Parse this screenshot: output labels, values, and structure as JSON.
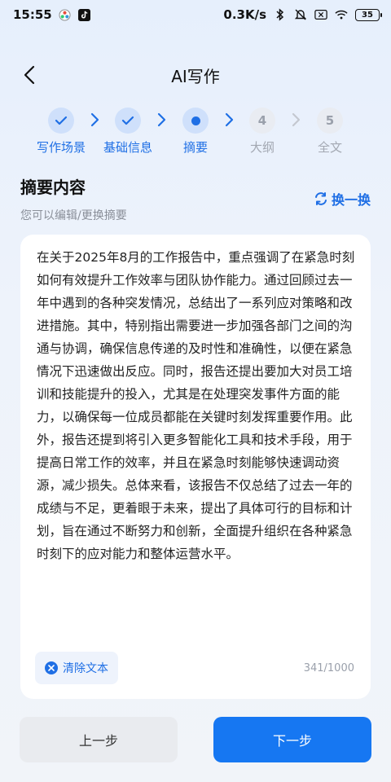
{
  "status_bar": {
    "time": "15:55",
    "network_speed": "0.3K/s",
    "battery": "35"
  },
  "nav": {
    "title": "AI写作"
  },
  "steps": [
    {
      "label": "写作场景",
      "state": "done"
    },
    {
      "label": "基础信息",
      "state": "done"
    },
    {
      "label": "摘要",
      "state": "active"
    },
    {
      "label": "大纲",
      "state": "pending",
      "number": "4"
    },
    {
      "label": "全文",
      "state": "pending",
      "number": "5"
    }
  ],
  "section": {
    "title": "摘要内容",
    "subtitle": "您可以编辑/更换摘要",
    "swap_label": "换一换"
  },
  "editor": {
    "content": "在关于2025年8月的工作报告中，重点强调了在紧急时刻如何有效提升工作效率与团队协作能力。通过回顾过去一年中遇到的各种突发情况，总结出了一系列应对策略和改进措施。其中，特别指出需要进一步加强各部门之间的沟通与协调，确保信息传递的及时性和准确性，以便在紧急情况下迅速做出反应。同时，报告还提出要加大对员工培训和技能提升的投入，尤其是在处理突发事件方面的能力，以确保每一位成员都能在关键时刻发挥重要作用。此外，报告还提到将引入更多智能化工具和技术手段，用于提高日常工作的效率，并且在紧急时刻能够快速调动资源，减少损失。总体来看，该报告不仅总结了过去一年的成绩与不足，更着眼于未来，提出了具体可行的目标和计划，旨在通过不断努力和创新，全面提升组织在各种紧急时刻下的应对能力和整体运营水平。",
    "clear_label": "清除文本",
    "char_count": "341/1000"
  },
  "footer": {
    "prev_label": "上一步",
    "next_label": "下一步"
  },
  "colors": {
    "accent": "#1f6fe5",
    "next_button": "#1677f2"
  }
}
